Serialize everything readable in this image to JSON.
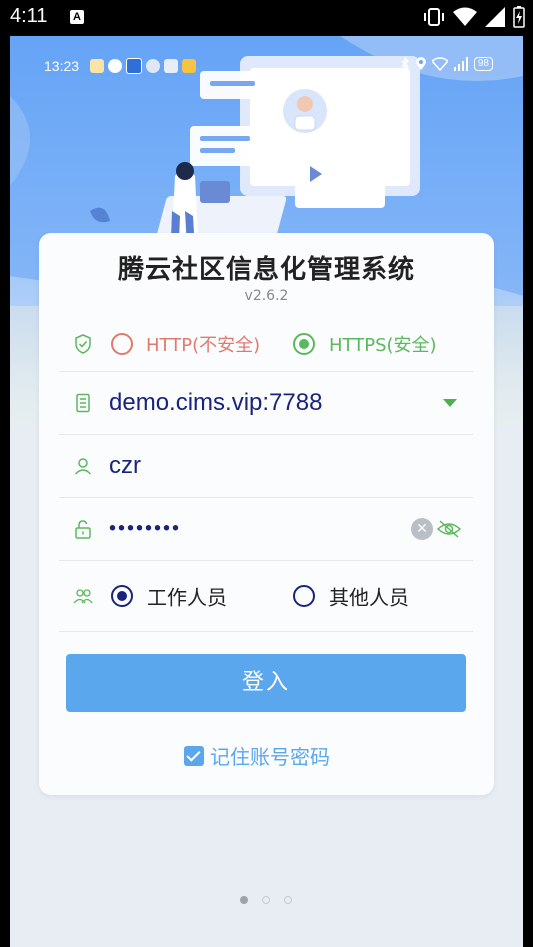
{
  "os_status": {
    "time": "4:11",
    "a_icon": "A"
  },
  "phone_status": {
    "time": "13:23",
    "battery": "98"
  },
  "app": {
    "title": "腾云社区信息化管理系统",
    "version": "v2.6.2"
  },
  "protocol": {
    "http_label": "HTTP(不安全)",
    "https_label": "HTTPS(安全)",
    "selected": "HTTPS(安全)"
  },
  "server": {
    "value": "demo.cims.vip:7788"
  },
  "username": {
    "value": "czr"
  },
  "password": {
    "value": "••••••••"
  },
  "role": {
    "staff_label": "工作人员",
    "other_label": "其他人员",
    "selected": "工作人员"
  },
  "login_button": {
    "label": "登入"
  },
  "remember": {
    "label": "记住账号密码",
    "checked": true
  },
  "page_indicator": {
    "count": 3,
    "active": 1
  },
  "colors": {
    "primary": "#5aa7ee",
    "https_green": "#5cb85c",
    "http_red": "#e07a6f",
    "text_navy": "#1a237e"
  }
}
